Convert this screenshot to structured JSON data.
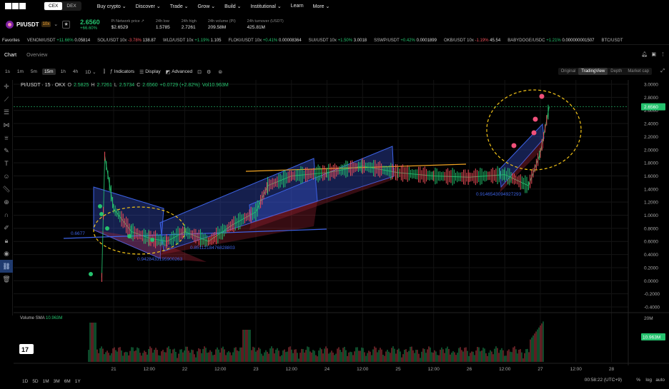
{
  "nav": {
    "logo": "OKX",
    "modes": [
      "CEX",
      "DEX"
    ],
    "items": [
      "Buy crypto",
      "Discover",
      "Trade",
      "Grow",
      "Build",
      "Institutional",
      "Learn",
      "More"
    ]
  },
  "ticker": {
    "pair": "PI/USDT",
    "leverage": "10x",
    "last_price": "2.6560",
    "change": "+66.60%",
    "stats": [
      {
        "label": "Pi Network price",
        "value": "$2.6529"
      },
      {
        "label": "24h low",
        "value": "1.5785"
      },
      {
        "label": "24h high",
        "value": "2.7261"
      },
      {
        "label": "24h volume (PI)",
        "value": "209.58M"
      },
      {
        "label": "24h turnover (USDT)",
        "value": "425.81M"
      }
    ]
  },
  "favorites": {
    "label": "Favorites",
    "items": [
      {
        "pair": "VENOM/USDT",
        "change": "+11.66%",
        "price": "0.05814",
        "dir": "up"
      },
      {
        "pair": "SOL/USDT 10x",
        "change": "-3.78%",
        "price": "138.87",
        "dir": "down"
      },
      {
        "pair": "WLD/USDT 10x",
        "change": "+1.19%",
        "price": "1.105",
        "dir": "up"
      },
      {
        "pair": "FLOKI/USDT 10x",
        "change": "+0.41%",
        "price": "0.00008364",
        "dir": "up"
      },
      {
        "pair": "SUI/USDT 10x",
        "change": "+1.50%",
        "price": "3.0018",
        "dir": "up"
      },
      {
        "pair": "SSWP/USDT",
        "change": "+0.42%",
        "price": "0.0001899",
        "dir": "up"
      },
      {
        "pair": "OKB/USDT 10x",
        "change": "-1.19%",
        "price": "45.54",
        "dir": "down"
      },
      {
        "pair": "BABYDOGE/USDC",
        "change": "+1.21%",
        "price": "0.000000001507",
        "dir": "up"
      },
      {
        "pair": "BTC/USDT",
        "change": "",
        "price": "",
        "dir": "up"
      }
    ]
  },
  "chart_tabs": [
    "Chart",
    "Overview"
  ],
  "toolbar": {
    "timeframes": [
      "1s",
      "1m",
      "5m",
      "15m",
      "1h",
      "4h",
      "1D"
    ],
    "active_timeframe": "15m",
    "indicators": "Indicators",
    "display": "Display",
    "advanced": "Advanced",
    "views": [
      "Original",
      "TradingView",
      "Depth",
      "Market cap"
    ],
    "active_view": "TradingView"
  },
  "legend": {
    "title": "PI/USDT · 15 · OKX",
    "o": "2.5825",
    "h": "2.7261",
    "l": "2.5734",
    "c": "2.6560",
    "chg": "+0.0729 (+2.82%)",
    "vol": "Vol10.963M"
  },
  "volume_label": {
    "name": "Volume SMA",
    "value": "10.963M"
  },
  "annotations": [
    "0.6677",
    "0.9428433195900263",
    "0.8511218476828803",
    "0.9146543094927293"
  ],
  "chart_data": {
    "type": "candlestick",
    "ylim": [
      -0.4,
      3.0
    ],
    "yticks": [
      "3.0000",
      "2.8000",
      "2.6000",
      "2.4000",
      "2.2000",
      "2.0000",
      "1.8000",
      "1.6000",
      "1.4000",
      "1.2000",
      "1.0000",
      "0.8000",
      "0.6000",
      "0.4000",
      "0.2000",
      "0.0000",
      "-0.2000",
      "-0.4000"
    ],
    "xticks": [
      "21",
      "12:00",
      "22",
      "12:00",
      "23",
      "12:00",
      "24",
      "12:00",
      "25",
      "12:00",
      "26",
      "12:00",
      "27",
      "12:00",
      "28"
    ],
    "last_price_tag": "2.6560",
    "volume_axis": "20M",
    "volume_tag": "10.963M",
    "price_path": [
      {
        "t": "20 20:00",
        "price": 0.05
      },
      {
        "t": "20 21:00",
        "price": 1.9
      },
      {
        "t": "21 00:00",
        "price": 1.1
      },
      {
        "t": "21 06:00",
        "price": 0.75
      },
      {
        "t": "21 12:00",
        "price": 0.65
      },
      {
        "t": "21 18:00",
        "price": 0.6
      },
      {
        "t": "22 00:00",
        "price": 0.75
      },
      {
        "t": "22 08:00",
        "price": 0.6
      },
      {
        "t": "22 16:00",
        "price": 0.85
      },
      {
        "t": "23 00:00",
        "price": 1.05
      },
      {
        "t": "23 04:00",
        "price": 1.45
      },
      {
        "t": "23 12:00",
        "price": 1.6
      },
      {
        "t": "24 00:00",
        "price": 1.65
      },
      {
        "t": "24 12:00",
        "price": 1.75
      },
      {
        "t": "25 00:00",
        "price": 1.65
      },
      {
        "t": "25 12:00",
        "price": 1.6
      },
      {
        "t": "26 00:00",
        "price": 1.58
      },
      {
        "t": "26 12:00",
        "price": 1.62
      },
      {
        "t": "26 20:00",
        "price": 1.45
      },
      {
        "t": "27 00:00",
        "price": 1.95
      },
      {
        "t": "27 03:00",
        "price": 2.656
      }
    ]
  },
  "bottom": {
    "ranges": [
      "1D",
      "5D",
      "1M",
      "3M",
      "6M",
      "1Y"
    ],
    "time": "00:58:22 (UTC+9)",
    "pct": "%",
    "log": "log",
    "auto": "auto"
  }
}
